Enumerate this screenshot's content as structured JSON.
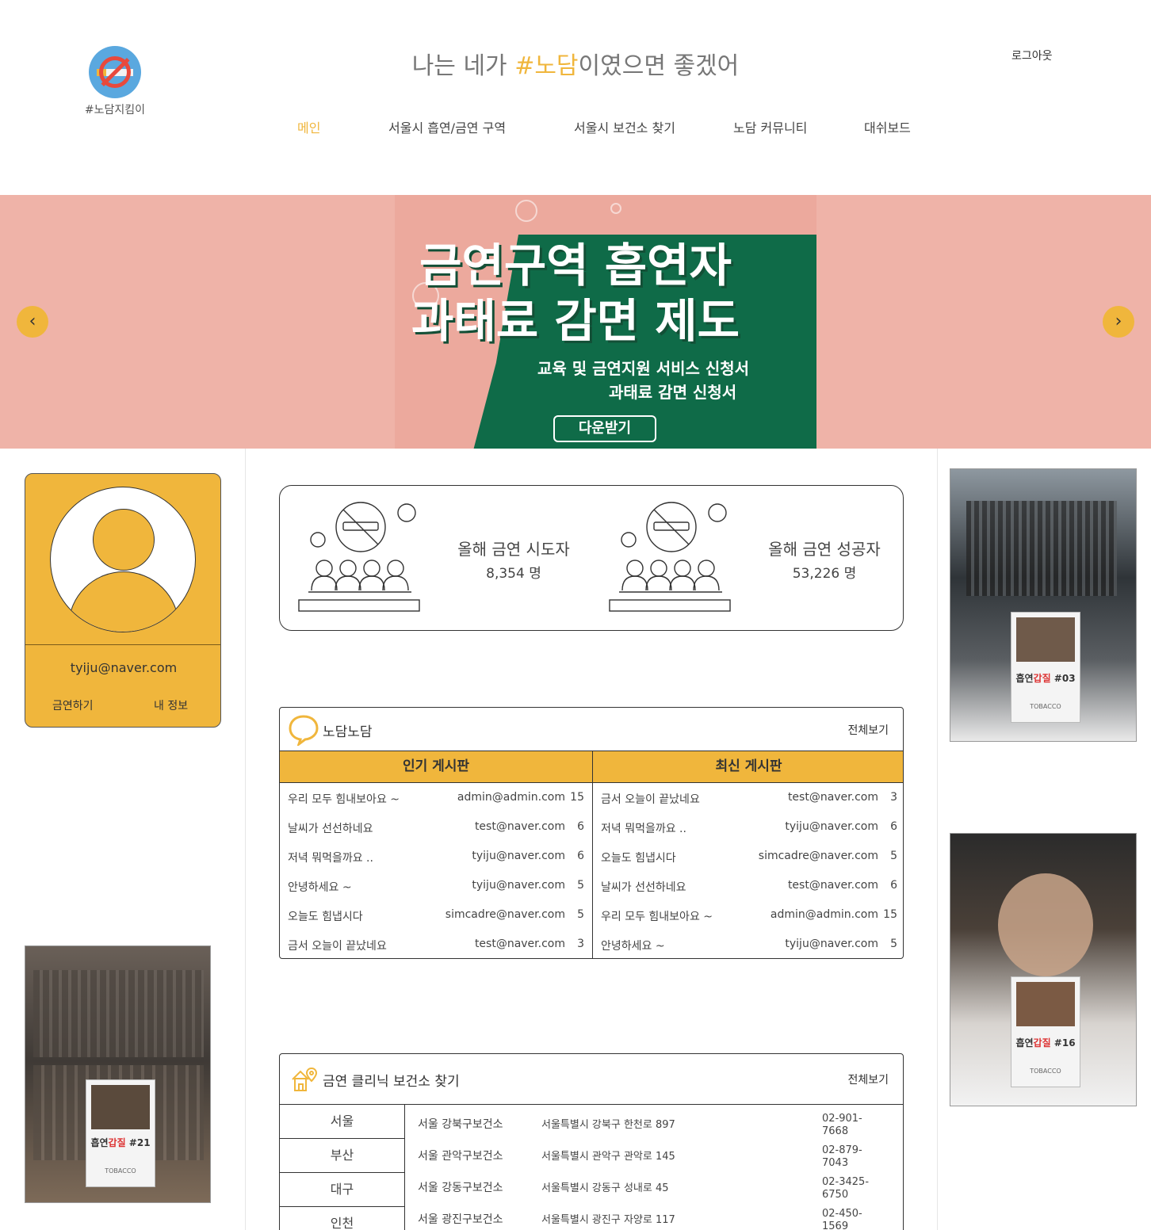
{
  "logo": {
    "text": "#노담지킴이",
    "icon": "no-smoking-logo-icon"
  },
  "header": {
    "title_prefix": "나는 네가 ",
    "title_highlight": "#노담",
    "title_suffix": "이였으면 좋겠어",
    "logout_label": "로그아웃"
  },
  "nav": {
    "items": [
      {
        "label": "메인",
        "active": true
      },
      {
        "label": "서울시 흡연/금연 구역"
      },
      {
        "label": "서울시 보건소 찾기"
      },
      {
        "label": "노담 커뮤니티"
      },
      {
        "label": "대쉬보드"
      }
    ]
  },
  "banner": {
    "line1": "금연구역 흡연자",
    "line2": "과태료 감면 제도",
    "sub1": "교육 및 금연지원 서비스 신청서",
    "sub2": "과태료 감면 신청서",
    "button_label": "다운받기",
    "prev_icon": "chevron-left-icon",
    "next_icon": "chevron-right-icon"
  },
  "profile": {
    "email": "tyiju@naver.com",
    "quit_label": "금연하기",
    "info_label": "내 정보"
  },
  "stats": {
    "challengers_label": "올해 금연 시도자",
    "challengers_value": "8,354 명",
    "success_label": "올해 금연 성공자",
    "success_value": "53,226 명"
  },
  "board": {
    "title": "노담노담",
    "more_label": "전체보기",
    "popular": {
      "header": "인기 게시판",
      "rows": [
        {
          "title": "우리 모두 힘내보아요 ~",
          "author": "admin@admin.com",
          "count": "15"
        },
        {
          "title": "날씨가 선선하네요",
          "author": "test@naver.com",
          "count": "6"
        },
        {
          "title": "저녁 뭐먹을까요 ..",
          "author": "tyiju@naver.com",
          "count": "6"
        },
        {
          "title": "안녕하세요 ~",
          "author": "tyiju@naver.com",
          "count": "5"
        },
        {
          "title": "오늘도 힘냅시다",
          "author": "simcadre@naver.com",
          "count": "5"
        },
        {
          "title": "금서 오늘이 끝났네요",
          "author": "test@naver.com",
          "count": "3"
        }
      ]
    },
    "recent": {
      "header": "최신 게시판",
      "rows": [
        {
          "title": "금서 오늘이 끝났네요",
          "author": "test@naver.com",
          "count": "3"
        },
        {
          "title": "저녁 뭐먹을까요 ..",
          "author": "tyiju@naver.com",
          "count": "6"
        },
        {
          "title": "오늘도 힘냅시다",
          "author": "simcadre@naver.com",
          "count": "5"
        },
        {
          "title": "날씨가 선선하네요",
          "author": "test@naver.com",
          "count": "6"
        },
        {
          "title": "우리 모두 힘내보아요 ~",
          "author": "admin@admin.com",
          "count": "15"
        },
        {
          "title": "안녕하세요 ~",
          "author": "tyiju@naver.com",
          "count": "5"
        }
      ]
    }
  },
  "clinic": {
    "title": "금연 클리닉 보건소 찾기",
    "more_label": "전체보기",
    "regions": [
      "서울",
      "부산",
      "대구",
      "인천"
    ],
    "rows": [
      {
        "name": "서울 강북구보건소",
        "address": "서울특별시 강북구 한천로 897",
        "phone": "02-901-7668"
      },
      {
        "name": "서울 관악구보건소",
        "address": "서울특별시 관악구 관악로 145",
        "phone": "02-879-7043"
      },
      {
        "name": "서울 강동구보건소",
        "address": "서울특별시 강동구 성내로 45",
        "phone": "02-3425-6750"
      },
      {
        "name": "서울 광진구보건소",
        "address": "서울특별시 광진구 자양로 117",
        "phone": "02-450-1569"
      }
    ]
  },
  "posters": [
    {
      "title_prefix": "흡연",
      "title_red": "갑질",
      "title_suffix": " #21",
      "sub": "TOBACCO"
    },
    {
      "title_prefix": "흡연",
      "title_red": "갑질",
      "title_suffix": " #03",
      "sub": "TOBACCO"
    },
    {
      "title_prefix": "흡연",
      "title_red": "갑질",
      "title_suffix": " #16",
      "sub": "TOBACCO"
    }
  ],
  "colors": {
    "accent": "#f0b63c",
    "banner_bg": "#efb3a8",
    "banner_green": "#0f6b48"
  }
}
